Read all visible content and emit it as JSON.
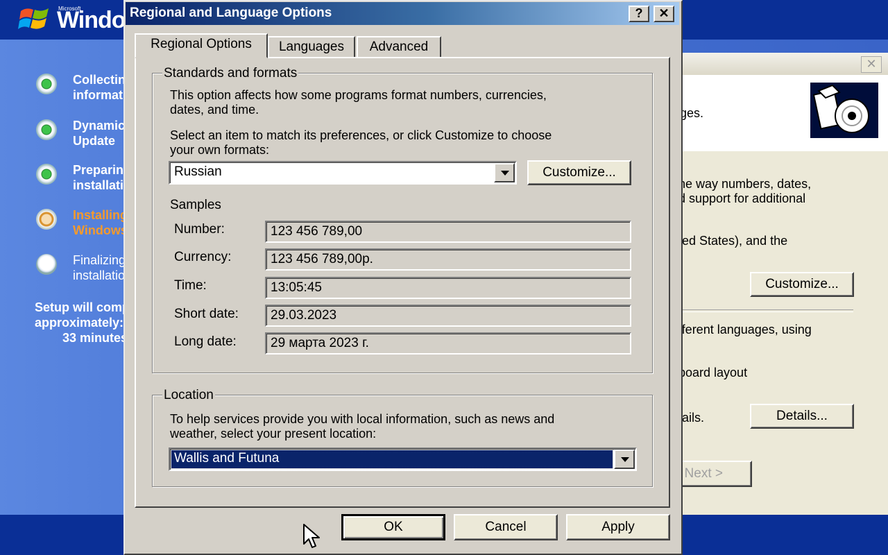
{
  "setup": {
    "brand_small": "Microsoft",
    "brand": "Windows",
    "steps": [
      {
        "label": "Collecting\ninformation",
        "state": "done"
      },
      {
        "label": "Dynamic\nUpdate",
        "state": "done"
      },
      {
        "label": "Preparing\ninstallation",
        "state": "done"
      },
      {
        "label": "Installing\nWindows",
        "state": "current"
      },
      {
        "label": "Finalizing\ninstallation",
        "state": "todo"
      }
    ],
    "time_line1": "Setup will complete in",
    "time_line2": "approximately:",
    "time_line3": "33 minutes"
  },
  "wizard": {
    "text_ges": "ges.",
    "text_l1": "he way numbers, dates,",
    "text_l2": "d support for additional",
    "text_l3": "ted States), and the",
    "customize_label": "Customize...",
    "text_l4": "fferent languages, using",
    "text_l5": "board layout",
    "text_l6": "tails.",
    "details_label": "Details...",
    "next_label": "Next >"
  },
  "dialog": {
    "title": "Regional and Language Options",
    "help_label": "?",
    "close_label": "✕",
    "tabs": [
      "Regional Options",
      "Languages",
      "Advanced"
    ],
    "standards": {
      "legend": "Standards and formats",
      "desc_line1": "This option affects how some programs format numbers, currencies,",
      "desc_line2": "dates, and time.",
      "select_line1": "Select an item to match its preferences, or click Customize to choose",
      "select_line2": "your own formats:",
      "selected_format": "Russian",
      "customize_label": "Customize..."
    },
    "samples": {
      "heading": "Samples",
      "rows": [
        {
          "label": "Number:",
          "value": "123 456 789,00"
        },
        {
          "label": "Currency:",
          "value": "123 456 789,00р."
        },
        {
          "label": "Time:",
          "value": "13:05:45"
        },
        {
          "label": "Short date:",
          "value": "29.03.2023"
        },
        {
          "label": "Long date:",
          "value": "29 марта 2023 г."
        }
      ]
    },
    "location": {
      "legend": "Location",
      "desc_line1": "To help services provide you with local information, such as news and",
      "desc_line2": "weather, select your present location:",
      "selected_location": "Wallis and Futuna"
    },
    "buttons": {
      "ok": "OK",
      "cancel": "Cancel",
      "apply": "Apply"
    }
  },
  "colors": {
    "title_active": "#0a246a",
    "selection": "#0a246a",
    "setup_blue": "#3a64c8",
    "current_step": "#f59a2c"
  }
}
